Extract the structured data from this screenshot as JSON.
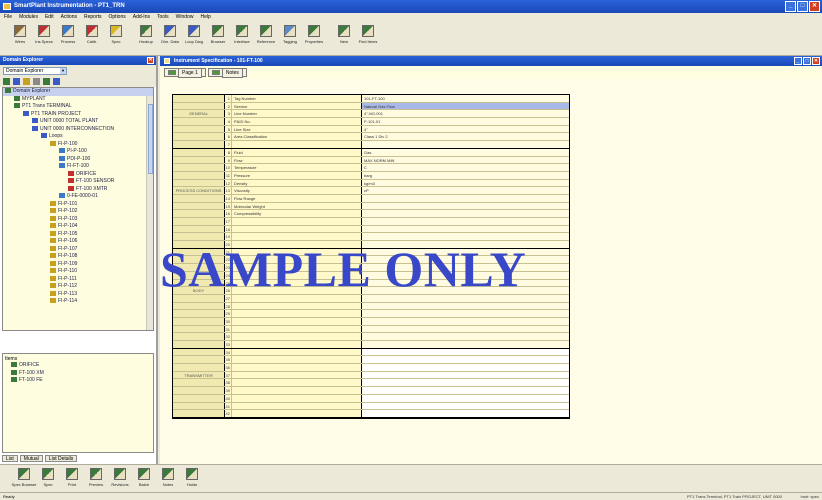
{
  "window": {
    "title": "SmartPlant Instrumentation - PT1_TRN"
  },
  "menu": [
    "File",
    "Modules",
    "Edit",
    "Actions",
    "Reports",
    "Options",
    "Add-Ins",
    "Tools",
    "Window",
    "Help"
  ],
  "toolbar": [
    {
      "label": "Wires",
      "icon": "wiring-icon",
      "color": "#8a6a3a"
    },
    {
      "label": "Ins.Specs",
      "icon": "spec-icon",
      "color": "#c03030"
    },
    {
      "label": "Process",
      "icon": "process-icon",
      "color": "#3a7ac8"
    },
    {
      "label": "Calib.",
      "icon": "calibration-icon",
      "color": "#c03030"
    },
    {
      "label": "Spec",
      "icon": "sheet-icon",
      "color": "#d8b820"
    },
    {
      "label": "",
      "icon": "separator"
    },
    {
      "label": "Hookup",
      "icon": "hookup-icon",
      "color": "#3a7a3a"
    },
    {
      "label": "Dim. Data",
      "icon": "dimension-icon",
      "color": "#3a5ac8"
    },
    {
      "label": "Loop Dwg",
      "icon": "loop-drawing-icon",
      "color": "#3a5ac8"
    },
    {
      "label": "Browser",
      "icon": "browser-icon",
      "color": "#3a7a3a"
    },
    {
      "label": "Interface",
      "icon": "interface-icon",
      "color": "#3a7a3a"
    },
    {
      "label": "Reference",
      "icon": "reference-icon",
      "color": "#3a7a3a"
    },
    {
      "label": "Tagging",
      "icon": "tagging-icon",
      "color": "#5a8ac8"
    },
    {
      "label": "Properties",
      "icon": "properties-icon",
      "color": "#3a7a3a"
    },
    {
      "label": "",
      "icon": "separator"
    },
    {
      "label": "New",
      "icon": "new-icon",
      "color": "#3a7a3a"
    },
    {
      "label": "Find Items",
      "icon": "find-icon",
      "color": "#3a7a3a"
    }
  ],
  "explorer": {
    "title": "Domain Explorer",
    "dropdown": "Domain Explorer",
    "tree": [
      {
        "label": "Domain Explorer",
        "depth": 0
      },
      {
        "label": "MYPLANT",
        "depth": 1
      },
      {
        "label": "PT1 Trans TERMINAL",
        "depth": 1
      },
      {
        "label": "PT1 TRAIN PROJECT",
        "depth": 2
      },
      {
        "label": "UNIT 0000 TOTAL PLANT",
        "depth": 3
      },
      {
        "label": "UNIT 0000 INTERCONNECTION",
        "depth": 3
      },
      {
        "label": "Loops",
        "depth": 4
      },
      {
        "label": "FI-P-100",
        "depth": 5
      },
      {
        "label": "PI-P-100",
        "depth": 6
      },
      {
        "label": "PDI-P-100",
        "depth": 6
      },
      {
        "label": "FI-FT-100",
        "depth": 6
      },
      {
        "label": "ORIFICE",
        "depth": 7
      },
      {
        "label": "FT-100 SENSOR",
        "depth": 7
      },
      {
        "label": "FT-100 XMTR",
        "depth": 7
      },
      {
        "label": "0-FE-0000-01",
        "depth": 6
      },
      {
        "label": "FI-P-101",
        "depth": 5
      },
      {
        "label": "FI-P-102",
        "depth": 5
      },
      {
        "label": "FI-P-103",
        "depth": 5
      },
      {
        "label": "FI-P-104",
        "depth": 5
      },
      {
        "label": "FI-P-105",
        "depth": 5
      },
      {
        "label": "FI-P-106",
        "depth": 5
      },
      {
        "label": "FI-P-107",
        "depth": 5
      },
      {
        "label": "FI-P-108",
        "depth": 5
      },
      {
        "label": "FI-P-109",
        "depth": 5
      },
      {
        "label": "FI-P-110",
        "depth": 5
      },
      {
        "label": "FI-P-111",
        "depth": 5
      },
      {
        "label": "FI-P-112",
        "depth": 5
      },
      {
        "label": "FI-P-113",
        "depth": 5
      },
      {
        "label": "FI-P-114",
        "depth": 5
      }
    ],
    "subpanel": {
      "title": "Items",
      "items": [
        "ORIFICE",
        "FT-100 XM",
        "FT-100 FE"
      ]
    },
    "tabs": [
      "List",
      "Mutual",
      "List Details"
    ]
  },
  "document": {
    "title": "Instrument Specification - 101-FT-100",
    "tabs": [
      "Page 1",
      "Notes"
    ],
    "sections": [
      {
        "name": "GENERAL",
        "rows": 7
      },
      {
        "name": "PROCESS CONDITIONS",
        "rows": 13
      },
      {
        "name": "BODY",
        "rows": 13
      },
      {
        "name": "TRANSMITTER",
        "rows": 9
      }
    ],
    "rows": [
      {
        "n": "1",
        "field": "Tag Number",
        "val": "101-FT-100",
        "style": ""
      },
      {
        "n": "2",
        "field": "Service",
        "val": "Natural Gas Flow",
        "style": "blue"
      },
      {
        "n": "3",
        "field": "Line Number",
        "val": "4\"-NG-001",
        "style": ""
      },
      {
        "n": "4",
        "field": "P&ID No.",
        "val": "P-101-01",
        "style": ""
      },
      {
        "n": "5",
        "field": "Line Size",
        "val": "4\"",
        "style": ""
      },
      {
        "n": "6",
        "field": "Area Classification",
        "val": "Class 1 Div 2",
        "style": ""
      },
      {
        "n": "7",
        "field": "",
        "val": "",
        "style": ""
      },
      {
        "n": "8",
        "field": "Fluid",
        "val": "Gas",
        "style": ""
      },
      {
        "n": "9",
        "field": "Flow",
        "val": "MAX NORM MIN",
        "style": ""
      },
      {
        "n": "10",
        "field": "Temperature",
        "val": "C",
        "style": ""
      },
      {
        "n": "11",
        "field": "Pressure",
        "val": "barg",
        "style": ""
      },
      {
        "n": "12",
        "field": "Density",
        "val": "kg/m3",
        "style": ""
      },
      {
        "n": "13",
        "field": "Viscosity",
        "val": "cP",
        "style": ""
      },
      {
        "n": "14",
        "field": "Flow Range",
        "val": "",
        "style": ""
      },
      {
        "n": "15",
        "field": "Molecular Weight",
        "val": "",
        "style": ""
      },
      {
        "n": "16",
        "field": "Compressibility",
        "val": "",
        "style": ""
      },
      {
        "n": "17",
        "field": "",
        "val": "",
        "style": ""
      },
      {
        "n": "18",
        "field": "",
        "val": "",
        "style": ""
      },
      {
        "n": "19",
        "field": "",
        "val": "",
        "style": ""
      },
      {
        "n": "20",
        "field": "",
        "val": "",
        "style": ""
      },
      {
        "n": "21",
        "field": "",
        "val": "",
        "style": ""
      },
      {
        "n": "22",
        "field": "",
        "val": "",
        "style": ""
      },
      {
        "n": "23",
        "field": "",
        "val": "",
        "style": ""
      },
      {
        "n": "24",
        "field": "",
        "val": "",
        "style": ""
      },
      {
        "n": "25",
        "field": "",
        "val": "",
        "style": ""
      },
      {
        "n": "26",
        "field": "",
        "val": "",
        "style": ""
      },
      {
        "n": "27",
        "field": "",
        "val": "",
        "style": ""
      },
      {
        "n": "28",
        "field": "",
        "val": "",
        "style": ""
      },
      {
        "n": "29",
        "field": "",
        "val": "",
        "style": ""
      },
      {
        "n": "30",
        "field": "",
        "val": "",
        "style": ""
      },
      {
        "n": "31",
        "field": "",
        "val": "",
        "style": ""
      },
      {
        "n": "32",
        "field": "",
        "val": "",
        "style": ""
      },
      {
        "n": "33",
        "field": "",
        "val": "",
        "style": ""
      },
      {
        "n": "34",
        "field": "",
        "val": "",
        "style": ""
      },
      {
        "n": "35",
        "field": "",
        "val": "",
        "style": ""
      },
      {
        "n": "36",
        "field": "",
        "val": "",
        "style": ""
      },
      {
        "n": "37",
        "field": "",
        "val": "",
        "style": ""
      },
      {
        "n": "38",
        "field": "",
        "val": "",
        "style": ""
      },
      {
        "n": "39",
        "field": "",
        "val": "",
        "style": ""
      },
      {
        "n": "40",
        "field": "",
        "val": "",
        "style": ""
      },
      {
        "n": "41",
        "field": "",
        "val": "",
        "style": ""
      },
      {
        "n": "42",
        "field": "",
        "val": "",
        "style": ""
      }
    ]
  },
  "watermark": "SAMPLE ONLY",
  "bottombar": [
    {
      "label": "Spec Browser",
      "icon": "spec-browser-icon",
      "color": "#3a7a3a"
    },
    {
      "label": "Spec",
      "icon": "spec-icon",
      "color": "#3a7a3a"
    },
    {
      "label": "Print",
      "icon": "print-icon",
      "color": "#3a7a3a"
    },
    {
      "label": "Preview",
      "icon": "preview-icon",
      "color": "#3a7a3a"
    },
    {
      "label": "Revisions",
      "icon": "revisions-icon",
      "color": "#3a7a3a"
    },
    {
      "label": "Batch",
      "icon": "batch-icon",
      "color": "#3a7a3a"
    },
    {
      "label": "Notes",
      "icon": "notes-icon",
      "color": "#3a7a3a"
    },
    {
      "label": "Holds",
      "icon": "holds-icon",
      "color": "#3a7a3a"
    }
  ],
  "status": {
    "left": "Ready",
    "right": "PT1 Trans Terminal, PT1 Train PROJECT, UNIT 0000",
    "far": "Instr: spec"
  }
}
